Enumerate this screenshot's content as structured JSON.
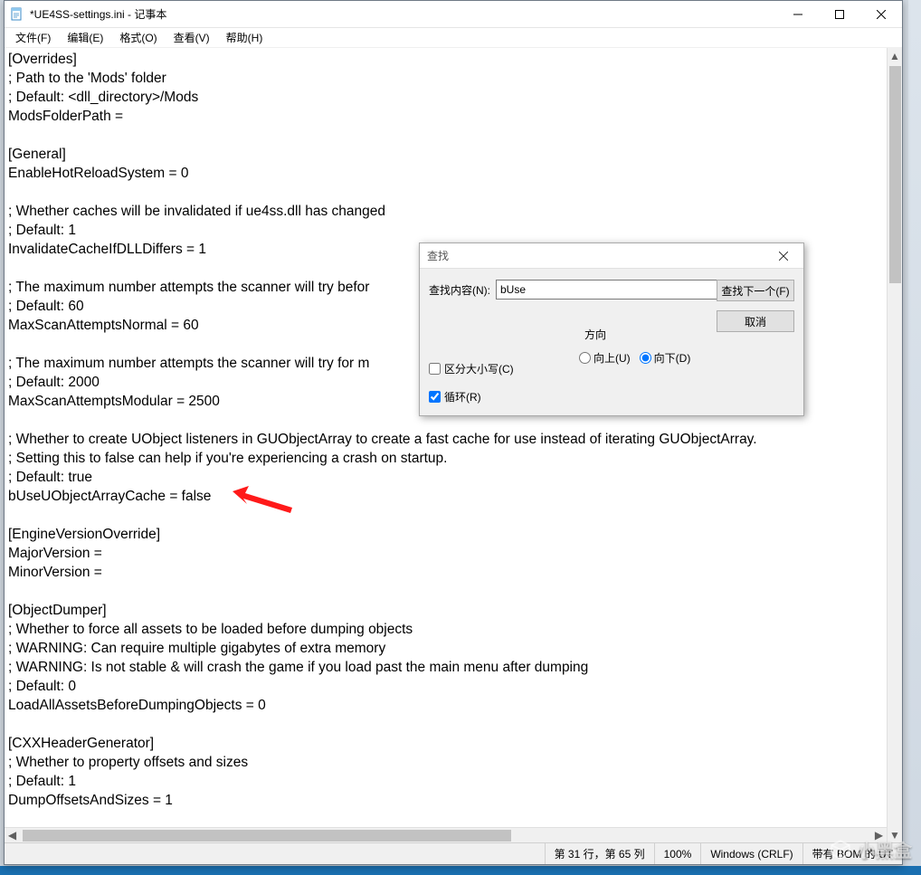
{
  "window": {
    "title": "*UE4SS-settings.ini - 记事本"
  },
  "menu": {
    "file": "文件(F)",
    "edit": "编辑(E)",
    "format": "格式(O)",
    "view": "查看(V)",
    "help": "帮助(H)"
  },
  "editor": {
    "text": "[Overrides]\n; Path to the 'Mods' folder\n; Default: <dll_directory>/Mods\nModsFolderPath =\n\n[General]\nEnableHotReloadSystem = 0\n\n; Whether caches will be invalidated if ue4ss.dll has changed\n; Default: 1\nInvalidateCacheIfDLLDiffers = 1\n\n; The maximum number attempts the scanner will try befor\n; Default: 60\nMaxScanAttemptsNormal = 60\n\n; The maximum number attempts the scanner will try for m\n; Default: 2000\nMaxScanAttemptsModular = 2500\n\n; Whether to create UObject listeners in GUObjectArray to create a fast cache for use instead of iterating GUObjectArray.\n; Setting this to false can help if you're experiencing a crash on startup.\n; Default: true\nbUseUObjectArrayCache = false\n\n[EngineVersionOverride]\nMajorVersion =\nMinorVersion =\n\n[ObjectDumper]\n; Whether to force all assets to be loaded before dumping objects\n; WARNING: Can require multiple gigabytes of extra memory\n; WARNING: Is not stable & will crash the game if you load past the main menu after dumping\n; Default: 0\nLoadAllAssetsBeforeDumpingObjects = 0\n\n[CXXHeaderGenerator]\n; Whether to property offsets and sizes\n; Default: 1\nDumpOffsetsAndSizes = 1\n"
  },
  "statusbar": {
    "pos": "第 31 行，第 65 列",
    "zoom": "100%",
    "eol": "Windows (CRLF)",
    "enc": "带有 BOM 的 UT"
  },
  "find": {
    "title": "查找",
    "label": "查找内容(N):",
    "value": "bUse",
    "findNext": "查找下一个(F)",
    "cancel": "取消",
    "matchCase": "区分大小写(C)",
    "wrap": "循环(R)",
    "direction": "方向",
    "up": "向上(U)",
    "down": "向下(D)",
    "matchCaseChecked": false,
    "wrapChecked": true,
    "downSelected": true
  },
  "watermark": {
    "text": "小黑盒"
  }
}
